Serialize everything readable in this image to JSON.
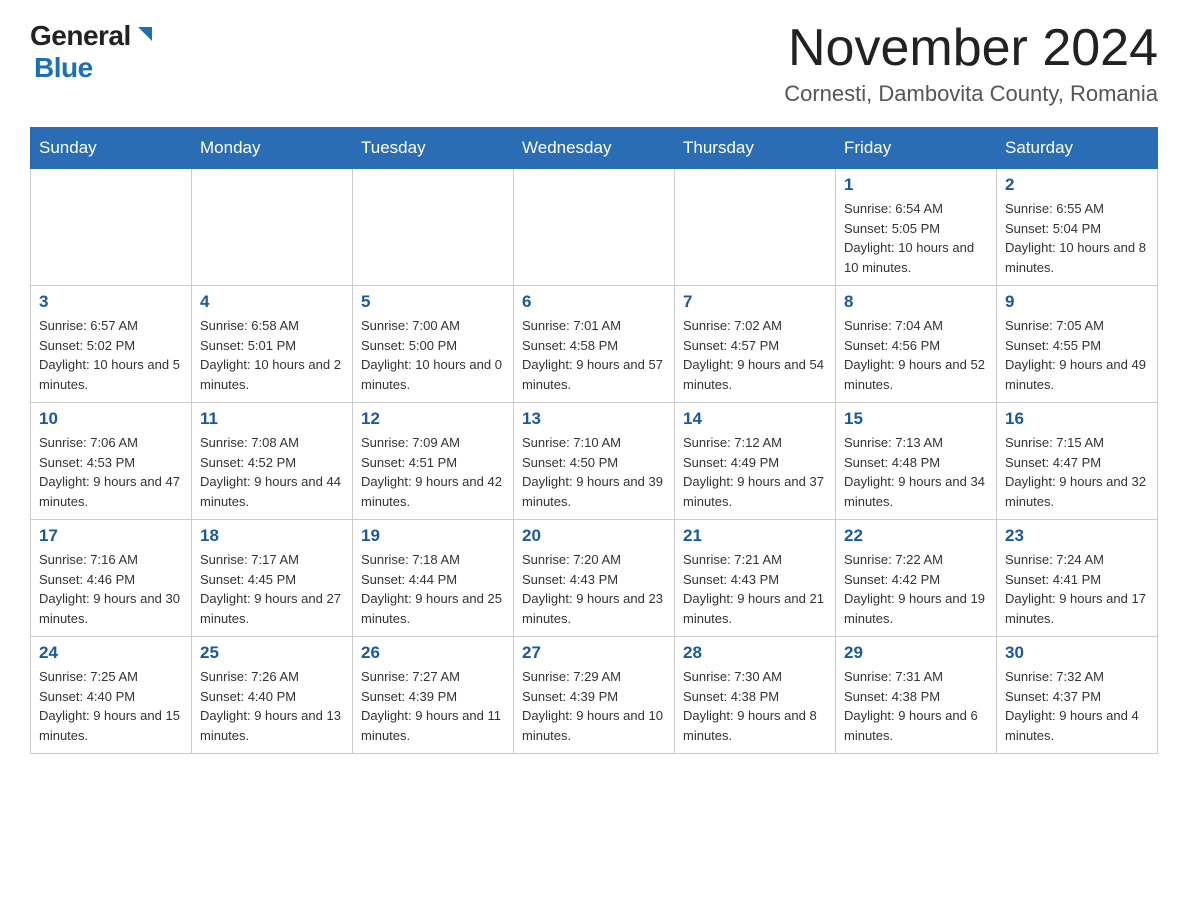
{
  "header": {
    "logo_general": "General",
    "logo_blue": "Blue",
    "month_title": "November 2024",
    "location": "Cornesti, Dambovita County, Romania"
  },
  "days_of_week": [
    "Sunday",
    "Monday",
    "Tuesday",
    "Wednesday",
    "Thursday",
    "Friday",
    "Saturday"
  ],
  "weeks": [
    [
      {
        "day": "",
        "info": ""
      },
      {
        "day": "",
        "info": ""
      },
      {
        "day": "",
        "info": ""
      },
      {
        "day": "",
        "info": ""
      },
      {
        "day": "",
        "info": ""
      },
      {
        "day": "1",
        "info": "Sunrise: 6:54 AM\nSunset: 5:05 PM\nDaylight: 10 hours and 10 minutes."
      },
      {
        "day": "2",
        "info": "Sunrise: 6:55 AM\nSunset: 5:04 PM\nDaylight: 10 hours and 8 minutes."
      }
    ],
    [
      {
        "day": "3",
        "info": "Sunrise: 6:57 AM\nSunset: 5:02 PM\nDaylight: 10 hours and 5 minutes."
      },
      {
        "day": "4",
        "info": "Sunrise: 6:58 AM\nSunset: 5:01 PM\nDaylight: 10 hours and 2 minutes."
      },
      {
        "day": "5",
        "info": "Sunrise: 7:00 AM\nSunset: 5:00 PM\nDaylight: 10 hours and 0 minutes."
      },
      {
        "day": "6",
        "info": "Sunrise: 7:01 AM\nSunset: 4:58 PM\nDaylight: 9 hours and 57 minutes."
      },
      {
        "day": "7",
        "info": "Sunrise: 7:02 AM\nSunset: 4:57 PM\nDaylight: 9 hours and 54 minutes."
      },
      {
        "day": "8",
        "info": "Sunrise: 7:04 AM\nSunset: 4:56 PM\nDaylight: 9 hours and 52 minutes."
      },
      {
        "day": "9",
        "info": "Sunrise: 7:05 AM\nSunset: 4:55 PM\nDaylight: 9 hours and 49 minutes."
      }
    ],
    [
      {
        "day": "10",
        "info": "Sunrise: 7:06 AM\nSunset: 4:53 PM\nDaylight: 9 hours and 47 minutes."
      },
      {
        "day": "11",
        "info": "Sunrise: 7:08 AM\nSunset: 4:52 PM\nDaylight: 9 hours and 44 minutes."
      },
      {
        "day": "12",
        "info": "Sunrise: 7:09 AM\nSunset: 4:51 PM\nDaylight: 9 hours and 42 minutes."
      },
      {
        "day": "13",
        "info": "Sunrise: 7:10 AM\nSunset: 4:50 PM\nDaylight: 9 hours and 39 minutes."
      },
      {
        "day": "14",
        "info": "Sunrise: 7:12 AM\nSunset: 4:49 PM\nDaylight: 9 hours and 37 minutes."
      },
      {
        "day": "15",
        "info": "Sunrise: 7:13 AM\nSunset: 4:48 PM\nDaylight: 9 hours and 34 minutes."
      },
      {
        "day": "16",
        "info": "Sunrise: 7:15 AM\nSunset: 4:47 PM\nDaylight: 9 hours and 32 minutes."
      }
    ],
    [
      {
        "day": "17",
        "info": "Sunrise: 7:16 AM\nSunset: 4:46 PM\nDaylight: 9 hours and 30 minutes."
      },
      {
        "day": "18",
        "info": "Sunrise: 7:17 AM\nSunset: 4:45 PM\nDaylight: 9 hours and 27 minutes."
      },
      {
        "day": "19",
        "info": "Sunrise: 7:18 AM\nSunset: 4:44 PM\nDaylight: 9 hours and 25 minutes."
      },
      {
        "day": "20",
        "info": "Sunrise: 7:20 AM\nSunset: 4:43 PM\nDaylight: 9 hours and 23 minutes."
      },
      {
        "day": "21",
        "info": "Sunrise: 7:21 AM\nSunset: 4:43 PM\nDaylight: 9 hours and 21 minutes."
      },
      {
        "day": "22",
        "info": "Sunrise: 7:22 AM\nSunset: 4:42 PM\nDaylight: 9 hours and 19 minutes."
      },
      {
        "day": "23",
        "info": "Sunrise: 7:24 AM\nSunset: 4:41 PM\nDaylight: 9 hours and 17 minutes."
      }
    ],
    [
      {
        "day": "24",
        "info": "Sunrise: 7:25 AM\nSunset: 4:40 PM\nDaylight: 9 hours and 15 minutes."
      },
      {
        "day": "25",
        "info": "Sunrise: 7:26 AM\nSunset: 4:40 PM\nDaylight: 9 hours and 13 minutes."
      },
      {
        "day": "26",
        "info": "Sunrise: 7:27 AM\nSunset: 4:39 PM\nDaylight: 9 hours and 11 minutes."
      },
      {
        "day": "27",
        "info": "Sunrise: 7:29 AM\nSunset: 4:39 PM\nDaylight: 9 hours and 10 minutes."
      },
      {
        "day": "28",
        "info": "Sunrise: 7:30 AM\nSunset: 4:38 PM\nDaylight: 9 hours and 8 minutes."
      },
      {
        "day": "29",
        "info": "Sunrise: 7:31 AM\nSunset: 4:38 PM\nDaylight: 9 hours and 6 minutes."
      },
      {
        "day": "30",
        "info": "Sunrise: 7:32 AM\nSunset: 4:37 PM\nDaylight: 9 hours and 4 minutes."
      }
    ]
  ]
}
